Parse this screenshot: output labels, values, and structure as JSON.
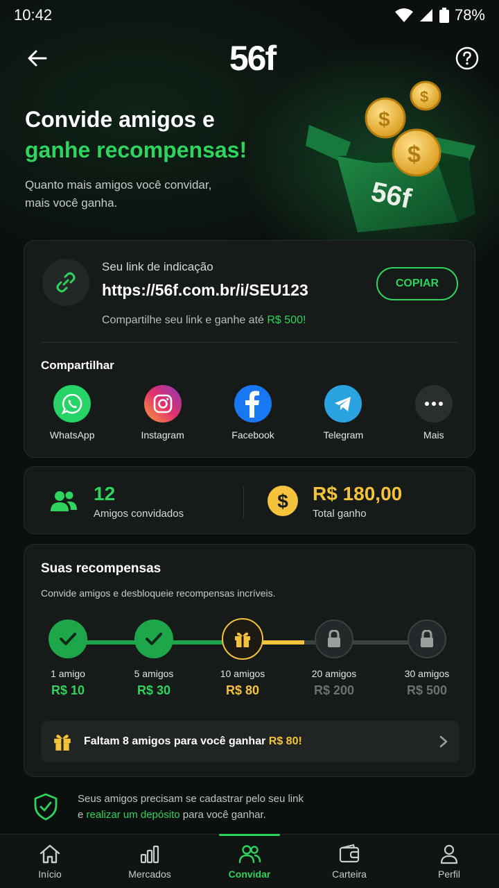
{
  "status_bar": {
    "time": "10:42",
    "battery": "78%"
  },
  "header": {
    "logo": "56f"
  },
  "hero": {
    "title_line1": "Convide amigos e",
    "title_line2": "ganhe recompensas!",
    "subtitle_line1": "Quanto mais amigos você convidar,",
    "subtitle_line2": "mais você ganha.",
    "box_logo": "56f"
  },
  "referral": {
    "label": "Seu link de indicação",
    "url": "https://56f.com.br/i/SEU123",
    "copy_label": "COPIAR",
    "note_prefix": "Compartilhe seu link e ganhe até ",
    "note_amount": "R$ 500!",
    "share_title": "Compartilhar",
    "share": [
      {
        "label": "WhatsApp",
        "icon": "whatsapp-icon",
        "color": "#25d366"
      },
      {
        "label": "Instagram",
        "icon": "instagram-icon",
        "color": "#e1306c"
      },
      {
        "label": "Facebook",
        "icon": "facebook-icon",
        "color": "#1877f2"
      },
      {
        "label": "Telegram",
        "icon": "telegram-icon",
        "color": "#2aa3e0"
      },
      {
        "label": "Mais",
        "icon": "more-icon",
        "color": "#2a2f2d"
      }
    ]
  },
  "stats": {
    "friends_count": "12",
    "friends_label": "Amigos convidados",
    "total_value": "R$ 180,00",
    "total_label": "Total ganho"
  },
  "rewards": {
    "title": "Suas recompensas",
    "subtitle": "Convide amigos e desbloqueie recompensas incríveis.",
    "steps": [
      {
        "count": "1 amigo",
        "amount": "R$ 10",
        "state": "done"
      },
      {
        "count": "5 amigos",
        "amount": "R$ 30",
        "state": "done"
      },
      {
        "count": "10 amigos",
        "amount": "R$ 80",
        "state": "current"
      },
      {
        "count": "20 amigos",
        "amount": "R$ 200",
        "state": "locked"
      },
      {
        "count": "30 amigos",
        "amount": "R$ 500",
        "state": "locked"
      }
    ],
    "goal_prefix": "Faltam 8 amigos para você ganhar ",
    "goal_amount": "R$ 80!"
  },
  "info": {
    "line1": "Seus amigos precisam se cadastrar pelo seu link",
    "line2_prefix": "e ",
    "line2_link": "realizar um depósito",
    "line2_suffix": " para você ganhar."
  },
  "nav": [
    {
      "label": "Início",
      "icon": "home-icon"
    },
    {
      "label": "Mercados",
      "icon": "chart-icon"
    },
    {
      "label": "Convidar",
      "icon": "users-icon",
      "active": true
    },
    {
      "label": "Carteira",
      "icon": "wallet-icon"
    },
    {
      "label": "Perfil",
      "icon": "user-icon"
    }
  ],
  "colors": {
    "accent": "#2fd45e",
    "gold": "#f5c33b",
    "background": "#0b0f0d",
    "card": "#161a18"
  }
}
